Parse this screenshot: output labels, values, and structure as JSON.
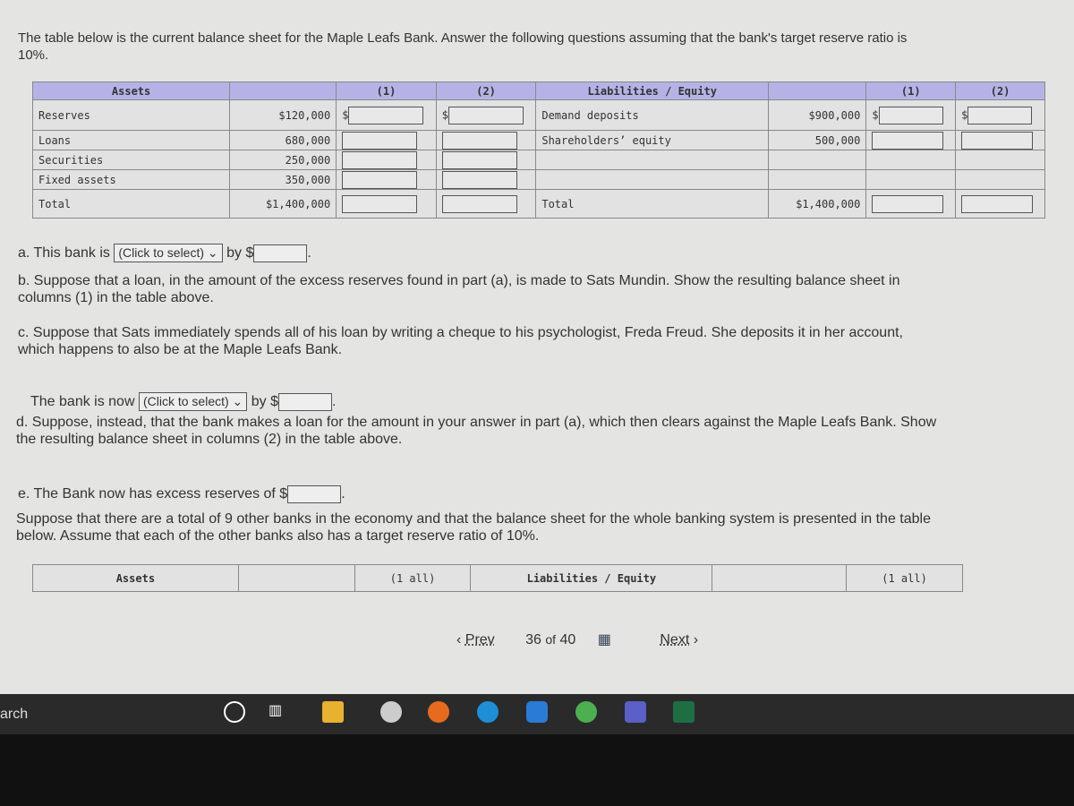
{
  "intro": "The table below is the current balance sheet for the Maple Leafs Bank. Answer the following questions assuming that the bank's target reserve ratio is 10%.",
  "table1": {
    "assets_header": "Assets",
    "col1": "(1)",
    "col2": "(2)",
    "liab_header": "Liabilities / Equity",
    "dollar": "$",
    "assets": [
      {
        "label": "Reserves",
        "value": "$120,000"
      },
      {
        "label": "Loans",
        "value": "680,000"
      },
      {
        "label": "Securities",
        "value": "250,000"
      },
      {
        "label": "Fixed assets",
        "value": "350,000"
      }
    ],
    "liabilities": [
      {
        "label": "Demand deposits",
        "value": "$900,000"
      },
      {
        "label": "Shareholders’ equity",
        "value": "500,000"
      }
    ],
    "total_label": "Total",
    "assets_total": "$1,400,000",
    "liab_total": "$1,400,000"
  },
  "qa": {
    "prefix": "a. This bank is",
    "select": "(Click to select)",
    "by": "by $"
  },
  "qb": "b. Suppose that a loan, in the amount of the excess reserves found in part (a), is made to Sats Mundin. Show the resulting balance sheet in columns (1) in the table above.",
  "qc": "c. Suppose that Sats immediately spends all of his loan by writing a cheque to his psychologist, Freda Freud. She deposits it in her account, which happens to also be at the Maple Leafs Bank.",
  "qc2": {
    "prefix": "The bank is now",
    "select": "(Click to select)",
    "by": "by $"
  },
  "qd": "d. Suppose, instead, that the bank makes a loan for the amount in your answer in part (a), which then clears against the Maple Leafs Bank. Show the resulting balance sheet in columns (2) in the table above.",
  "qe": "e. The Bank now has excess reserves of $",
  "system": "Suppose that there are a total of 9 other banks in the economy and that the balance sheet for the whole banking system is presented in the table below. Assume that each of the other banks also has a target reserve ratio of 10%.",
  "table2": {
    "assets_header": "Assets",
    "col": "(1 all)",
    "liab_header": "Liabilities / Equity",
    "col2": "(1 all)"
  },
  "nav": {
    "prev": "Prev",
    "page": "36",
    "of": "of",
    "total": "40",
    "next": "Next"
  },
  "taskbar": {
    "search": "arch"
  }
}
